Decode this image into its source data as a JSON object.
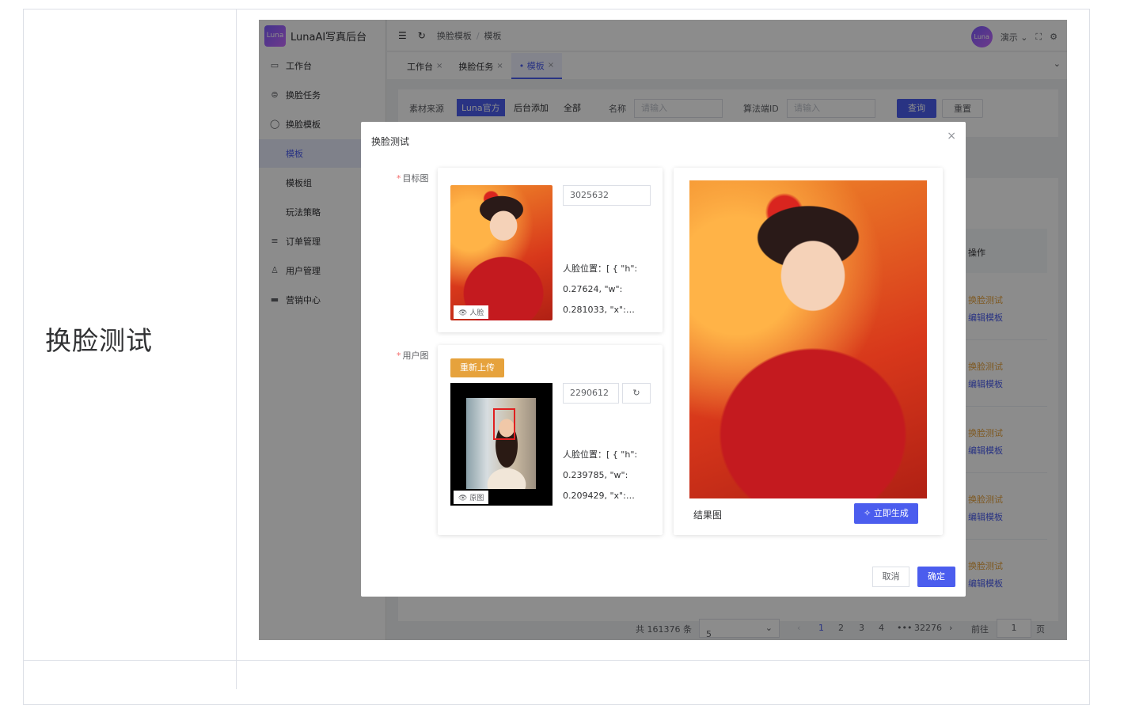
{
  "row_label": "换脸测试",
  "app": {
    "logo_badge": "Luna",
    "title": "LunaAI写真后台"
  },
  "sidebar": {
    "items": [
      {
        "label": "工作台",
        "icon": "monitor-icon"
      },
      {
        "label": "换脸任务",
        "icon": "task-icon"
      },
      {
        "label": "换脸模板",
        "icon": "template-icon"
      },
      {
        "label": "模板",
        "sub": true,
        "active": true
      },
      {
        "label": "模板组",
        "sub": true
      },
      {
        "label": "玩法策略",
        "sub": true
      },
      {
        "label": "订单管理",
        "icon": "database-icon"
      },
      {
        "label": "用户管理",
        "icon": "user-icon"
      },
      {
        "label": "营销中心",
        "icon": "gift-icon"
      }
    ]
  },
  "topbar": {
    "breadcrumb": [
      "换脸模板",
      "模板"
    ],
    "avatar_text": "Luna",
    "user_name": "演示"
  },
  "tabs": [
    {
      "label": "工作台"
    },
    {
      "label": "换脸任务"
    },
    {
      "label": "• 模板",
      "active": true
    }
  ],
  "filter": {
    "source_label": "素材来源",
    "source_options": [
      "Luna官方",
      "后台添加",
      "全部"
    ],
    "name_label": "名称",
    "name_placeholder": "请输入",
    "algo_label": "算法端ID",
    "algo_placeholder": "请输入",
    "query_label": "查询",
    "reset_label": "重置"
  },
  "table": {
    "op_header": "操作",
    "row_actions": [
      {
        "test": "换脸测试",
        "edit": "编辑模板"
      },
      {
        "test": "换脸测试",
        "edit": "编辑模板"
      },
      {
        "test": "换脸测试",
        "edit": "编辑模板"
      },
      {
        "test": "换脸测试",
        "edit": "编辑模板"
      },
      {
        "test": "换脸测试",
        "edit": "编辑模板"
      }
    ]
  },
  "pager": {
    "total": "共 161376 条",
    "page_size": "5",
    "pages": [
      "1",
      "2",
      "3",
      "4",
      "•••",
      "32276"
    ],
    "current_page": "1",
    "goto_label": "前往",
    "goto_value": "1",
    "page_unit": "页"
  },
  "dialog": {
    "title": "换脸测试",
    "target": {
      "label": "目标图",
      "id": "3025632",
      "face_info": "人脸位置：[ { \"h\": 0.27624, \"w\": 0.281033, \"x\":…",
      "tag": "人脸"
    },
    "user": {
      "label": "用户图",
      "reupload": "重新上传",
      "id": "2290612",
      "face_info": "人脸位置：[ { \"h\": 0.239785, \"w\": 0.209429, \"x\":…",
      "tag": "原图"
    },
    "result": {
      "label": "结果图",
      "generate": "立即生成"
    },
    "cancel": "取消",
    "confirm": "确定"
  },
  "colors": {
    "primary": "#4b5dee",
    "warning": "#e6a23c",
    "danger": "#f56c6c"
  }
}
